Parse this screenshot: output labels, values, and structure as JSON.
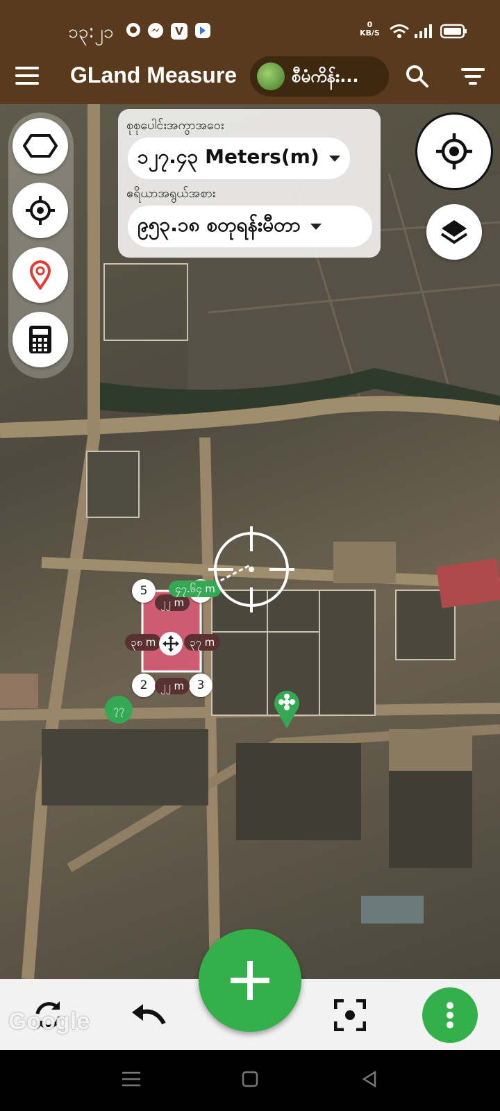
{
  "status_bar": {
    "time": "၁၃:၂၁",
    "notifications": [
      "chat-bubble-icon",
      "messenger-icon",
      "viber-icon",
      "wallet-icon"
    ],
    "net_speed": "0",
    "net_speed_unit": "KB/S",
    "system_icons": [
      "wifi-icon",
      "signal-icon",
      "battery-icon"
    ]
  },
  "app_bar": {
    "title": "GLand Measure",
    "project_name": "စီမံကိန်း...",
    "actions": [
      "search-icon",
      "filter-icon"
    ]
  },
  "info_panel": {
    "perimeter_label": "စုစုပေါင်းအကွာအဝေး",
    "perimeter_value": "၁၂၇.၄၃ Meters(m)",
    "area_label": "ဧရိယာအရွယ်အစား",
    "area_value": "၉၅၃.၁၈ စတုရန်းမီတာ"
  },
  "left_tools": [
    "polygon-shape-icon",
    "gps-target-icon",
    "location-pin-icon",
    "calculator-icon"
  ],
  "polygon": {
    "vertices": [
      "5",
      "4",
      "3",
      "2"
    ],
    "edge_lengths": {
      "top": "၂၂ m",
      "bottom": "၂၂ m",
      "left": "၃၈ m",
      "right": "၃၇ m"
    },
    "area_badge": "၇၇",
    "live_distance": "၄၇.၆၄ m",
    "fill_color": "#e05a78",
    "stroke_color": "#ffffff"
  },
  "map": {
    "attribution": "Google"
  },
  "bottom_bar": {
    "actions": [
      "refresh-icon",
      "undo-icon",
      "add-point-icon",
      "focus-icon",
      "more-vertical-icon"
    ]
  },
  "colors": {
    "app_bar": "#5a3a1c",
    "accent_green": "#34b04a",
    "poly_fill": "#e05a78"
  }
}
